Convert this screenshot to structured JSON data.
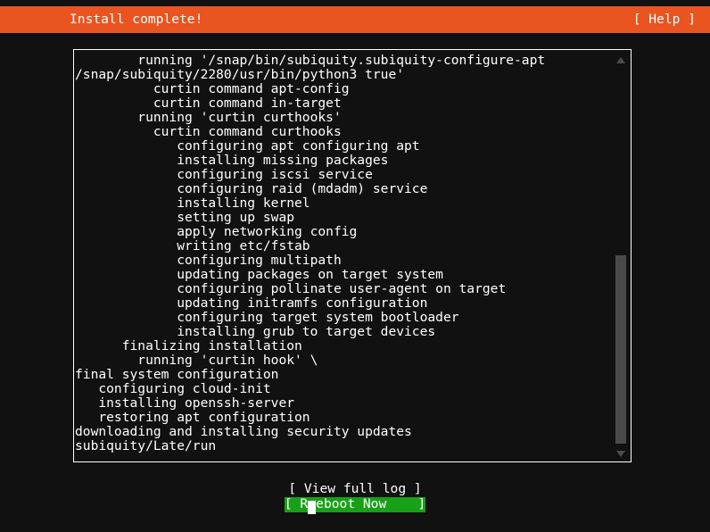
{
  "header": {
    "title": "Install complete!",
    "help_label": "[ Help ]",
    "bg_color": "#e95420",
    "text_color": "#ffffff"
  },
  "log": {
    "lines": [
      "        running '/snap/bin/subiquity.subiquity-configure-apt",
      "/snap/subiquity/2280/usr/bin/python3 true'",
      "          curtin command apt-config",
      "          curtin command in-target",
      "        running 'curtin curthooks'",
      "          curtin command curthooks",
      "             configuring apt configuring apt",
      "             installing missing packages",
      "             configuring iscsi service",
      "             configuring raid (mdadm) service",
      "             installing kernel",
      "             setting up swap",
      "             apply networking config",
      "             writing etc/fstab",
      "             configuring multipath",
      "             updating packages on target system",
      "             configuring pollinate user-agent on target",
      "             updating initramfs configuration",
      "             configuring target system bootloader",
      "             installing grub to target devices",
      "      finalizing installation",
      "        running 'curtin hook' \\",
      "final system configuration",
      "   configuring cloud-init",
      "   installing openssh-server",
      "   restoring apt configuration",
      "downloading and installing security updates",
      "subiquity/Late/run"
    ],
    "text_color": "#ffffff",
    "border_color": "#ffffff",
    "background_color": "#111111"
  },
  "scrollbar": {
    "up_arrow": "scroll-up-arrow",
    "down_arrow": "scroll-down-arrow",
    "thumb_color": "#4a4a4a",
    "arrow_color": "#4b4b4b"
  },
  "footer": {
    "view_log_label": "[ View full log ]",
    "reboot_prefix": "[ R",
    "reboot_suffix": "eboot Now    ]",
    "selected_bg": "#18a018"
  }
}
